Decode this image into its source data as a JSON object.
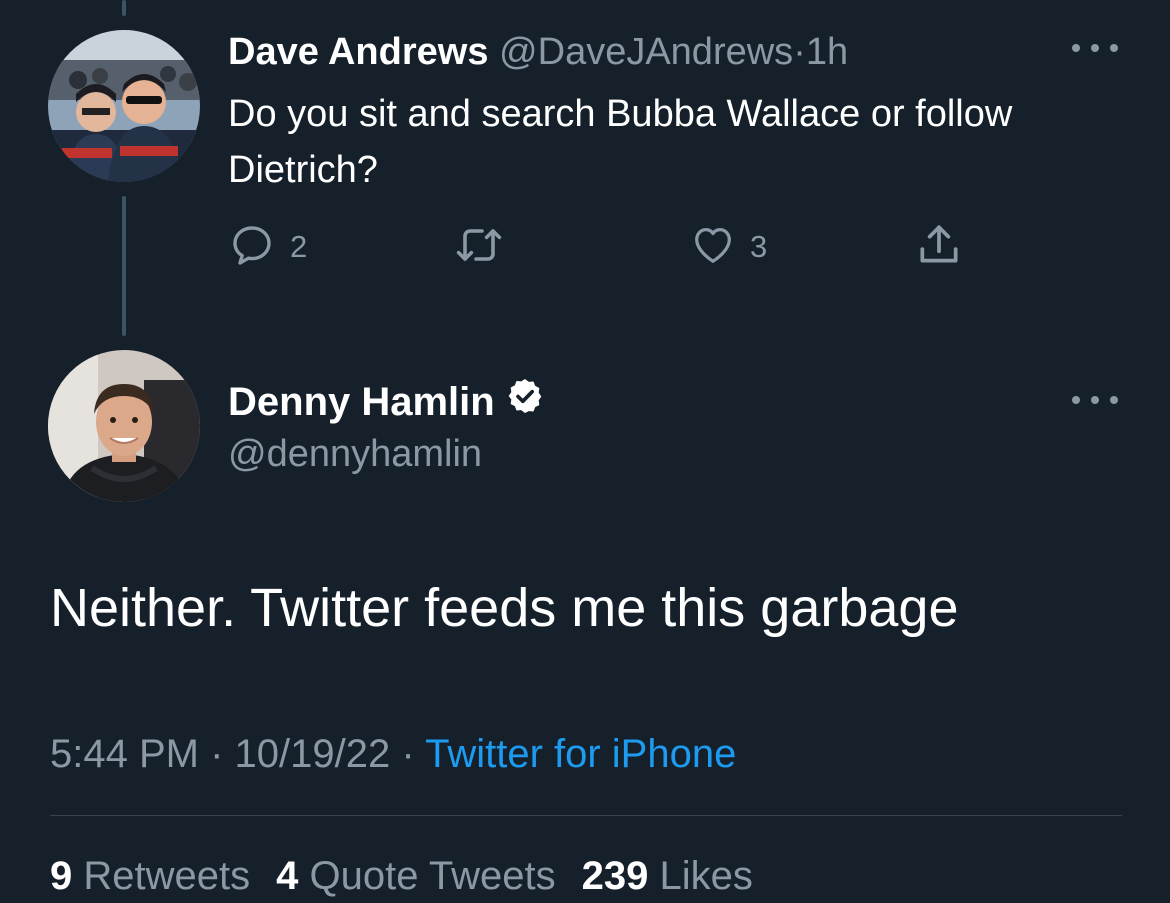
{
  "reply_tweet": {
    "author_name": "Dave Andrews",
    "handle": "@DaveJAndrews",
    "separator": "·",
    "time_ago": "1h",
    "text": "Do you sit and search Bubba Wallace or follow Dietrich?",
    "reply_count": "2",
    "retweet_count": "",
    "like_count": "3"
  },
  "main_tweet": {
    "author_name": "Denny Hamlin",
    "handle": "@dennyhamlin",
    "text": "Neither. Twitter feeds me this garbage",
    "time": "5:44 PM",
    "separator": "·",
    "date": "10/19/22",
    "source": "Twitter for iPhone",
    "stats": {
      "retweets_count": "9",
      "retweets_label": "Retweets",
      "quote_count": "4",
      "quote_label": "Quote Tweets",
      "likes_count": "239",
      "likes_label": "Likes"
    }
  },
  "colors": {
    "background": "#15202b",
    "muted_text": "#8b98a5",
    "link": "#1d9bf0",
    "thread_line": "#3d5466",
    "divider": "#38444d"
  },
  "icons": {
    "reply": "speech-bubble-icon",
    "retweet": "retweet-arrows-icon",
    "like": "heart-outline-icon",
    "share": "share-upload-icon",
    "more": "three-dots-icon",
    "verified": "verified-badge-icon"
  }
}
